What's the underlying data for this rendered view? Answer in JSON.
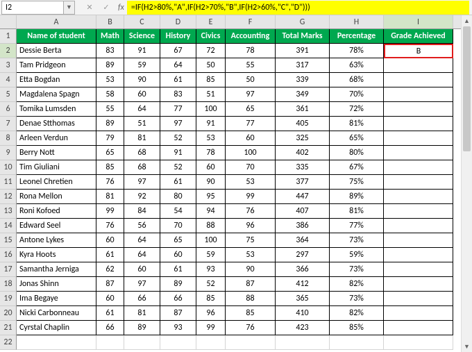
{
  "namebox": "I2",
  "formula": "=IF(H2>80%,\"A\",IF(H2>70%,\"B\",IF(H2>60%,\"C\",\"D\")))",
  "columns": [
    "A",
    "B",
    "C",
    "D",
    "E",
    "F",
    "G",
    "H",
    "I"
  ],
  "active_col": "I",
  "active_row": 2,
  "headers": [
    "Name of student",
    "Math",
    "Science",
    "History",
    "Civics",
    "Accounting",
    "Total Marks",
    "Percentage",
    "Grade Achieved"
  ],
  "rows": [
    {
      "n": 2,
      "name": "Dessie Berta",
      "math": 83,
      "sci": 91,
      "hist": 67,
      "civ": 72,
      "acc": 78,
      "tot": 391,
      "pct": "78%",
      "grade": "B"
    },
    {
      "n": 3,
      "name": "Tam Pridgeon",
      "math": 89,
      "sci": 59,
      "hist": 64,
      "civ": 50,
      "acc": 55,
      "tot": 317,
      "pct": "63%",
      "grade": ""
    },
    {
      "n": 4,
      "name": "Etta Bogdan",
      "math": 53,
      "sci": 90,
      "hist": 61,
      "civ": 85,
      "acc": 50,
      "tot": 339,
      "pct": "68%",
      "grade": ""
    },
    {
      "n": 5,
      "name": "Magdalena Spagn",
      "math": 58,
      "sci": 60,
      "hist": 83,
      "civ": 51,
      "acc": 97,
      "tot": 349,
      "pct": "70%",
      "grade": ""
    },
    {
      "n": 6,
      "name": "Tomika Lumsden",
      "math": 55,
      "sci": 64,
      "hist": 77,
      "civ": 100,
      "acc": 65,
      "tot": 361,
      "pct": "72%",
      "grade": ""
    },
    {
      "n": 7,
      "name": "Denae Stthomas",
      "math": 89,
      "sci": 51,
      "hist": 97,
      "civ": 91,
      "acc": 77,
      "tot": 405,
      "pct": "81%",
      "grade": ""
    },
    {
      "n": 8,
      "name": "Arleen Verdun",
      "math": 79,
      "sci": 81,
      "hist": 52,
      "civ": 53,
      "acc": 60,
      "tot": 325,
      "pct": "65%",
      "grade": ""
    },
    {
      "n": 9,
      "name": "Berry Nott",
      "math": 65,
      "sci": 68,
      "hist": 91,
      "civ": 78,
      "acc": 100,
      "tot": 402,
      "pct": "80%",
      "grade": ""
    },
    {
      "n": 10,
      "name": "Tim Giuliani",
      "math": 85,
      "sci": 68,
      "hist": 52,
      "civ": 60,
      "acc": 70,
      "tot": 335,
      "pct": "67%",
      "grade": ""
    },
    {
      "n": 11,
      "name": "Leonel Chretien",
      "math": 76,
      "sci": 97,
      "hist": 61,
      "civ": 90,
      "acc": 53,
      "tot": 377,
      "pct": "75%",
      "grade": ""
    },
    {
      "n": 12,
      "name": "Rona Mellon",
      "math": 81,
      "sci": 92,
      "hist": 80,
      "civ": 95,
      "acc": 99,
      "tot": 447,
      "pct": "89%",
      "grade": ""
    },
    {
      "n": 13,
      "name": "Roni Kofoed",
      "math": 99,
      "sci": 84,
      "hist": 54,
      "civ": 94,
      "acc": 76,
      "tot": 407,
      "pct": "81%",
      "grade": ""
    },
    {
      "n": 14,
      "name": "Edward Seel",
      "math": 76,
      "sci": 56,
      "hist": 70,
      "civ": 88,
      "acc": 96,
      "tot": 386,
      "pct": "77%",
      "grade": ""
    },
    {
      "n": 15,
      "name": "Antone Lykes",
      "math": 60,
      "sci": 64,
      "hist": 65,
      "civ": 100,
      "acc": 75,
      "tot": 364,
      "pct": "73%",
      "grade": ""
    },
    {
      "n": 16,
      "name": "Kyra Hoots",
      "math": 61,
      "sci": 64,
      "hist": 60,
      "civ": 59,
      "acc": 53,
      "tot": 297,
      "pct": "59%",
      "grade": ""
    },
    {
      "n": 17,
      "name": "Samantha Jerniga",
      "math": 62,
      "sci": 60,
      "hist": 61,
      "civ": 93,
      "acc": 90,
      "tot": 366,
      "pct": "73%",
      "grade": ""
    },
    {
      "n": 18,
      "name": "Jonas Shinn",
      "math": 87,
      "sci": 97,
      "hist": 89,
      "civ": 52,
      "acc": 87,
      "tot": 412,
      "pct": "82%",
      "grade": ""
    },
    {
      "n": 19,
      "name": "Ima Begaye",
      "math": 60,
      "sci": 66,
      "hist": 66,
      "civ": 85,
      "acc": 88,
      "tot": 365,
      "pct": "73%",
      "grade": ""
    },
    {
      "n": 20,
      "name": "Nicki Carbonneau",
      "math": 61,
      "sci": 81,
      "hist": 87,
      "civ": 96,
      "acc": 85,
      "tot": 410,
      "pct": "82%",
      "grade": ""
    },
    {
      "n": 21,
      "name": "Cyrstal Chaplin",
      "math": 66,
      "sci": 89,
      "hist": 93,
      "civ": 99,
      "acc": 76,
      "tot": 423,
      "pct": "85%",
      "grade": ""
    }
  ],
  "chart_data": {
    "type": "table",
    "title": "Student Grades",
    "columns": [
      "Name of student",
      "Math",
      "Science",
      "History",
      "Civics",
      "Accounting",
      "Total Marks",
      "Percentage",
      "Grade Achieved"
    ],
    "data": [
      [
        "Dessie Berta",
        83,
        91,
        67,
        72,
        78,
        391,
        "78%",
        "B"
      ],
      [
        "Tam Pridgeon",
        89,
        59,
        64,
        50,
        55,
        317,
        "63%",
        ""
      ],
      [
        "Etta Bogdan",
        53,
        90,
        61,
        85,
        50,
        339,
        "68%",
        ""
      ],
      [
        "Magdalena Spagn",
        58,
        60,
        83,
        51,
        97,
        349,
        "70%",
        ""
      ],
      [
        "Tomika Lumsden",
        55,
        64,
        77,
        100,
        65,
        361,
        "72%",
        ""
      ],
      [
        "Denae Stthomas",
        89,
        51,
        97,
        91,
        77,
        405,
        "81%",
        ""
      ],
      [
        "Arleen Verdun",
        79,
        81,
        52,
        53,
        60,
        325,
        "65%",
        ""
      ],
      [
        "Berry Nott",
        65,
        68,
        91,
        78,
        100,
        402,
        "80%",
        ""
      ],
      [
        "Tim Giuliani",
        85,
        68,
        52,
        60,
        70,
        335,
        "67%",
        ""
      ],
      [
        "Leonel Chretien",
        76,
        97,
        61,
        90,
        53,
        377,
        "75%",
        ""
      ],
      [
        "Rona Mellon",
        81,
        92,
        80,
        95,
        99,
        447,
        "89%",
        ""
      ],
      [
        "Roni Kofoed",
        99,
        84,
        54,
        94,
        76,
        407,
        "81%",
        ""
      ],
      [
        "Edward Seel",
        76,
        56,
        70,
        88,
        96,
        386,
        "77%",
        ""
      ],
      [
        "Antone Lykes",
        60,
        64,
        65,
        100,
        75,
        364,
        "73%",
        ""
      ],
      [
        "Kyra Hoots",
        61,
        64,
        60,
        59,
        53,
        297,
        "59%",
        ""
      ],
      [
        "Samantha Jerniga",
        62,
        60,
        61,
        93,
        90,
        366,
        "73%",
        ""
      ],
      [
        "Jonas Shinn",
        87,
        97,
        89,
        52,
        87,
        412,
        "82%",
        ""
      ],
      [
        "Ima Begaye",
        60,
        66,
        66,
        85,
        88,
        365,
        "73%",
        ""
      ],
      [
        "Nicki Carbonneau",
        61,
        81,
        87,
        96,
        85,
        410,
        "82%",
        ""
      ],
      [
        "Cyrstal Chaplin",
        66,
        89,
        93,
        99,
        76,
        423,
        "85%",
        ""
      ]
    ]
  }
}
